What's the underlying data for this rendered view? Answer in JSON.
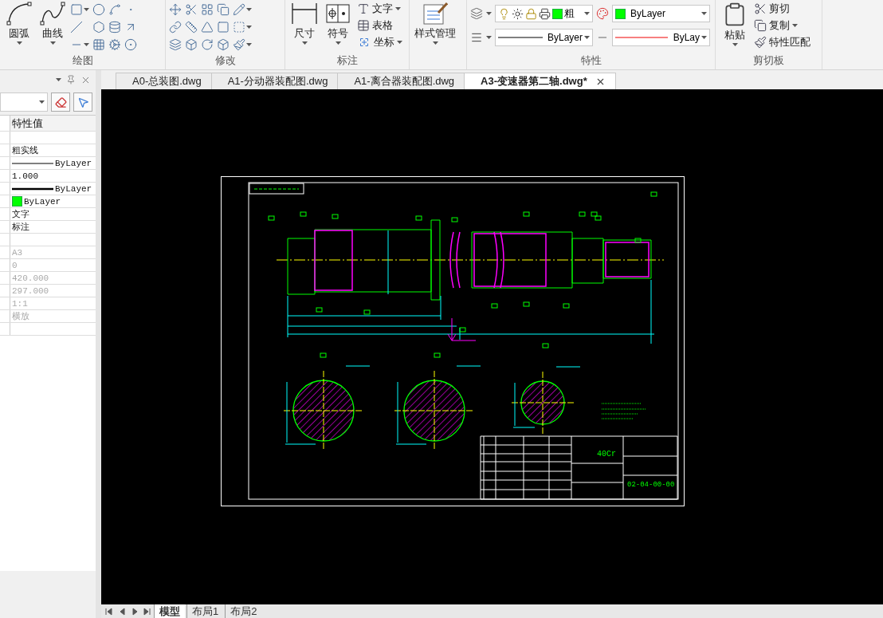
{
  "ribbon": [
    {
      "kind": "draw",
      "title": "绘图",
      "large": [
        {
          "label": "圆弧"
        },
        {
          "label": "曲线"
        }
      ]
    },
    {
      "kind": "modify",
      "title": "修改"
    },
    {
      "kind": "annotate",
      "title": "标注",
      "large": [
        {
          "label": "尺寸"
        },
        {
          "label": "符号"
        }
      ],
      "small": [
        {
          "label": "文字",
          "dropdown": true
        },
        {
          "label": "表格",
          "dropdown": false
        },
        {
          "label": "坐标",
          "dropdown": true
        }
      ]
    },
    {
      "kind": "style",
      "large": [
        {
          "label": "样式管理"
        }
      ]
    },
    {
      "kind": "properties",
      "title": "特性",
      "layer": "粗",
      "color_combo": "ByLayer",
      "linetype": "ByLayer",
      "lineweight": "ByLay"
    },
    {
      "kind": "clipboard",
      "title": "剪切板",
      "large": [
        {
          "label": "粘贴"
        }
      ],
      "small": [
        {
          "label": "剪切",
          "dropdown": false
        },
        {
          "label": "复制",
          "dropdown": true
        },
        {
          "label": "特性匹配",
          "dropdown": false
        }
      ]
    }
  ],
  "document_tabs": [
    {
      "label": "A0-总装图.dwg",
      "selected": false
    },
    {
      "label": "A1-分动器装配图.dwg",
      "selected": false
    },
    {
      "label": "A1-离合器装配图.dwg",
      "selected": false
    },
    {
      "label": "A3-变速器第二轴.dwg*",
      "selected": true
    }
  ],
  "properties_panel": {
    "header": "特性值",
    "rows": [
      {
        "kind": "category"
      },
      {
        "kind": "text",
        "value": "粗实线",
        "disabled": false
      },
      {
        "kind": "line",
        "value": "ByLayer",
        "disabled": false
      },
      {
        "kind": "text",
        "value": "1.000",
        "disabled": false
      },
      {
        "kind": "thickline",
        "value": "ByLayer",
        "disabled": false
      },
      {
        "kind": "swatch",
        "value": "ByLayer",
        "disabled": false
      },
      {
        "kind": "text",
        "value": "文字",
        "disabled": false
      },
      {
        "kind": "text",
        "value": "标注",
        "disabled": false
      },
      {
        "kind": "category"
      },
      {
        "kind": "text",
        "value": "A3",
        "disabled": true
      },
      {
        "kind": "text",
        "value": "0",
        "disabled": true
      },
      {
        "kind": "text",
        "value": "420.000",
        "disabled": true
      },
      {
        "kind": "text",
        "value": "297.000",
        "disabled": true
      },
      {
        "kind": "text",
        "value": "1:1",
        "disabled": true
      },
      {
        "kind": "text",
        "value": "横放",
        "disabled": true
      },
      {
        "kind": "category"
      }
    ]
  },
  "drawing": {
    "material": "40Cr",
    "drawing_number": "02-04-00-00"
  },
  "layout_tabs": [
    {
      "label": "模型",
      "selected": true
    },
    {
      "label": "布局1",
      "selected": false
    },
    {
      "label": "布局2",
      "selected": false
    }
  ]
}
